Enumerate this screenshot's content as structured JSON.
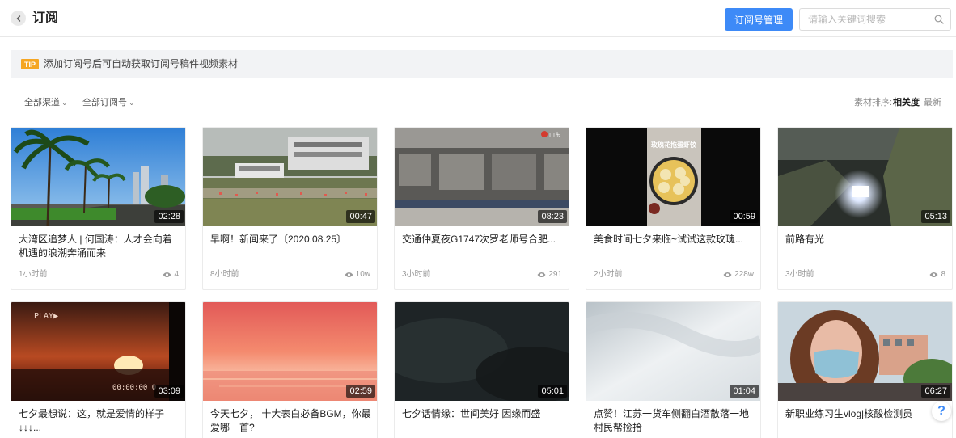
{
  "header": {
    "title": "订阅",
    "manage_button": "订阅号管理",
    "search_placeholder": "请输入关键词搜索"
  },
  "tip": {
    "badge": "TIP",
    "text": "添加订阅号后可自动获取订阅号稿件视频素材"
  },
  "filters": {
    "channel": "全部渠道",
    "subscription": "全部订阅号"
  },
  "sort": {
    "label": "素材排序:",
    "options": [
      "相关度",
      "最新"
    ],
    "active": "相关度"
  },
  "videos": [
    {
      "title": "大湾区追梦人 | 何国涛：人才会向着机遇的浪潮奔涌而来",
      "duration": "02:28",
      "time": "1小时前",
      "views": "4"
    },
    {
      "title": "早啊！新闻来了〔2020.08.25〕",
      "duration": "00:47",
      "time": "8小时前",
      "views": "10w"
    },
    {
      "title": "交通仲夏夜G1747次罗老师号合肥...",
      "duration": "08:23",
      "time": "3小时前",
      "views": "291"
    },
    {
      "title": "美食时间七夕来临~试试这款玫瑰...",
      "duration": "00:59",
      "time": "2小时前",
      "views": "228w"
    },
    {
      "title": "前路有光",
      "duration": "05:13",
      "time": "3小时前",
      "views": "8"
    },
    {
      "title": "七夕最想说：这，就是爱情的样子↓↓↓...",
      "duration": "03:09"
    },
    {
      "title": "今天七夕， 十大表白必备BGM，你最爱哪一首?",
      "duration": "02:59"
    },
    {
      "title": "七夕话情缘：世间美好 因缘而盛",
      "duration": "05:01"
    },
    {
      "title": "点赞！江苏一货车侧翻白酒散落一地 村民帮捡拾",
      "duration": "01:04"
    },
    {
      "title": "新职业练习生vlog|核酸检测员",
      "duration": "06:27"
    }
  ],
  "thumb_text": {
    "video3_logo": "山东",
    "video4_caption": "玫瑰花拖蛋虾饺",
    "video6_play": "PLAY▶",
    "video6_timecode": "00:00:00 0"
  },
  "help": "?",
  "colors": {
    "primary": "#3d8af7",
    "tip_badge": "#f5a623",
    "tip_bg": "#f2f3f5"
  }
}
